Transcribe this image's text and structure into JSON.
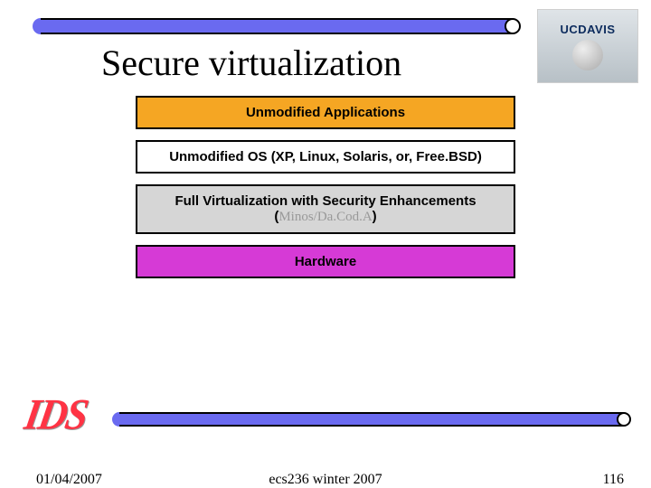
{
  "logo": {
    "line1": "UCDAVIS"
  },
  "title": "Secure virtualization",
  "stack": {
    "apps": "Unmodified Applications",
    "os": "Unmodified OS (XP, Linux, Solaris, or, Free.BSD)",
    "virt_main": "Full Virtualization with Security Enhancements",
    "virt_sub_open": "(",
    "virt_sub": "Minos/Da.Cod.A",
    "virt_sub_close": ")",
    "hw": "Hardware"
  },
  "side_label": "IDS",
  "footer": {
    "date": "01/04/2007",
    "course": "ecs236 winter 2007",
    "page": "116"
  }
}
